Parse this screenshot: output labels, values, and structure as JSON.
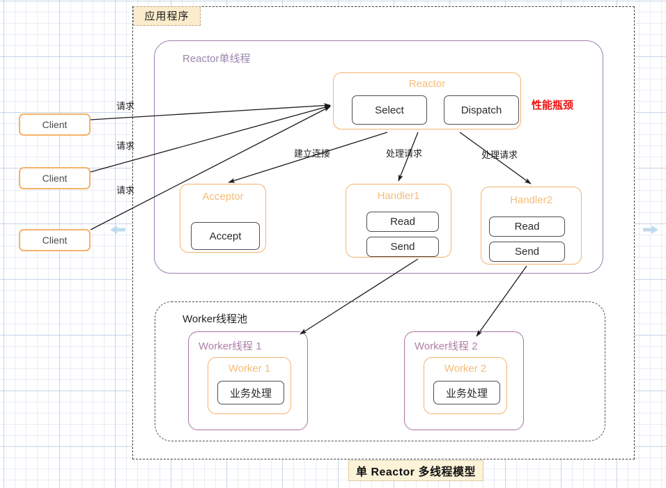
{
  "diagram": {
    "title": "单 Reactor 多线程模型",
    "app_boundary_label": "应用程序",
    "bottleneck_label": "性能瓶颈",
    "reactor_group_label": "Reactor单线程",
    "worker_pool_label": "Worker线程池"
  },
  "clients": [
    {
      "label": "Client"
    },
    {
      "label": "Client"
    },
    {
      "label": "Client"
    }
  ],
  "reactor": {
    "title": "Reactor",
    "select_label": "Select",
    "dispatch_label": "Dispatch"
  },
  "acceptor": {
    "title": "Acceptor",
    "accept_label": "Accept"
  },
  "handlers": [
    {
      "title": "Handler1",
      "read_label": "Read",
      "send_label": "Send"
    },
    {
      "title": "Handler2",
      "read_label": "Read",
      "send_label": "Send"
    }
  ],
  "workers": [
    {
      "thread_title": "Worker线程 1",
      "worker_title": "Worker 1",
      "task_label": "业务处理"
    },
    {
      "thread_title": "Worker线程 2",
      "worker_title": "Worker 2",
      "task_label": "业务处理"
    }
  ],
  "edge_labels": {
    "request_1": "请求",
    "request_2": "请求",
    "request_3": "请求",
    "establish_connection": "建立连接",
    "handle_request_1": "处理请求",
    "handle_request_2": "处理请求"
  },
  "colors": {
    "orange": "#f5b26b",
    "purple": "#9b7fae",
    "magenta": "#a8719b",
    "red": "#ee1111",
    "banner_bg": "#fdf3d9",
    "tag_bg": "#fbeccd",
    "blue_arrow": "#bfdcee"
  },
  "icons": {
    "left_scroll": "left-arrow-icon",
    "right_scroll": "right-arrow-icon"
  }
}
